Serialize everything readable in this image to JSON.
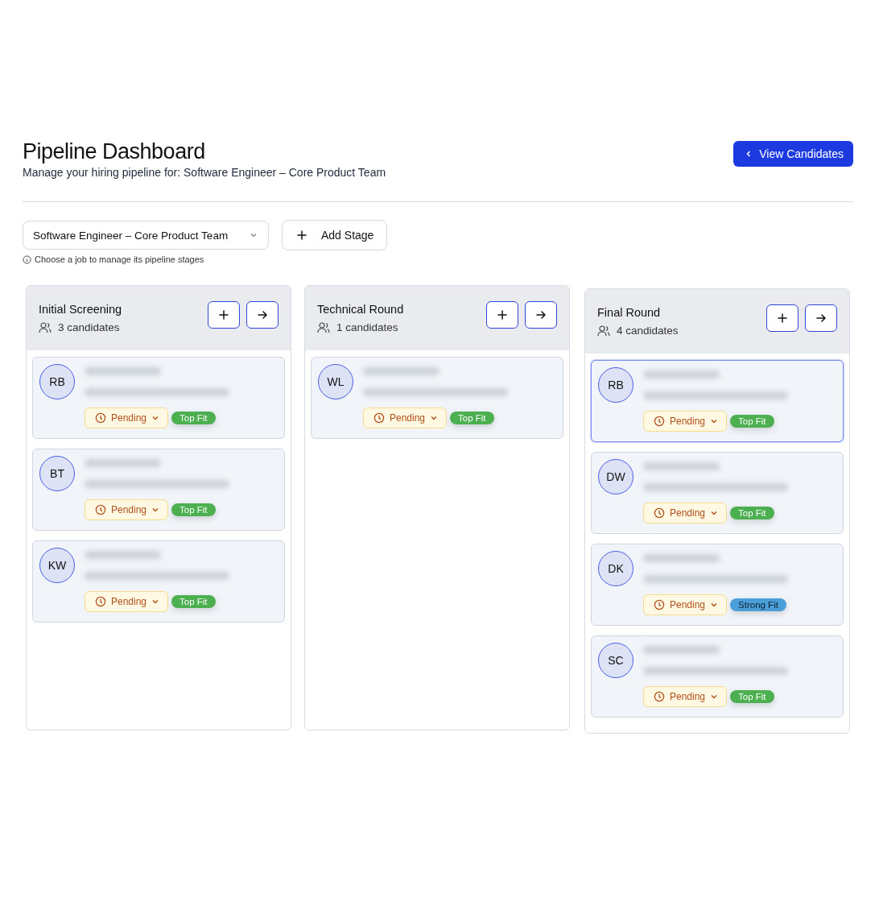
{
  "header": {
    "title": "Pipeline Dashboard",
    "subtitle": "Manage your hiring pipeline for: Software Engineer – Core Product Team",
    "view_button": {
      "label": "View Candidates"
    }
  },
  "job_select": {
    "value": "Software Engineer – Core Product Team",
    "hint": "Choose a job to manage its pipeline stages"
  },
  "add_stage": {
    "label": "Add Stage"
  },
  "stages": [
    {
      "title": "Initial Screening",
      "count": "3 candidates",
      "candidates": [
        {
          "initials": "RB",
          "status": "Pending",
          "fit": {
            "label": "Top Fit",
            "color": "#4caf50"
          },
          "selected": false
        },
        {
          "initials": "BT",
          "status": "Pending",
          "fit": {
            "label": "Top Fit",
            "color": "#4caf50"
          },
          "selected": false
        },
        {
          "initials": "KW",
          "status": "Pending",
          "fit": {
            "label": "Top Fit",
            "color": "#4caf50"
          },
          "selected": false
        }
      ]
    },
    {
      "title": "Technical Round",
      "count": "1 candidates",
      "candidates": [
        {
          "initials": "WL",
          "status": "Pending",
          "fit": {
            "label": "Top Fit",
            "color": "#4caf50"
          },
          "selected": false
        }
      ]
    },
    {
      "title": "Final Round",
      "count": "4 candidates",
      "candidates": [
        {
          "initials": "RB",
          "status": "Pending",
          "fit": {
            "label": "Top Fit",
            "color": "#4caf50"
          },
          "selected": true
        },
        {
          "initials": "DW",
          "status": "Pending",
          "fit": {
            "label": "Top Fit",
            "color": "#4caf50"
          },
          "selected": false
        },
        {
          "initials": "DK",
          "status": "Pending",
          "fit": {
            "label": "Strong Fit",
            "color": "#4a9fd8"
          },
          "selected": false
        },
        {
          "initials": "SC",
          "status": "Pending",
          "fit": {
            "label": "Top Fit",
            "color": "#4caf50"
          },
          "selected": false
        }
      ]
    }
  ]
}
